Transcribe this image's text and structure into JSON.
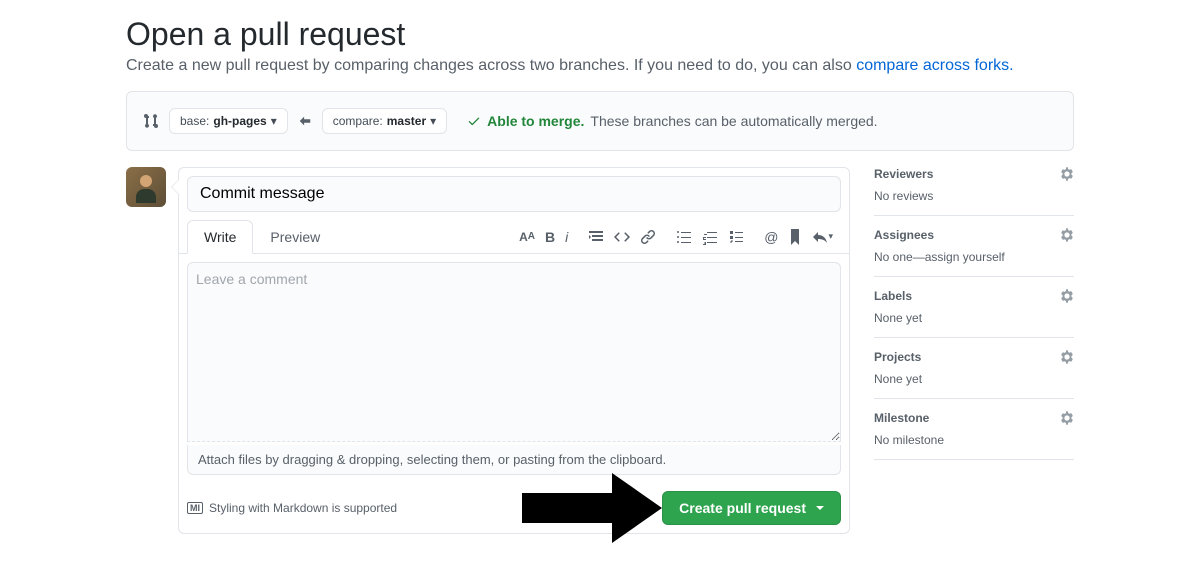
{
  "header": {
    "title": "Open a pull request",
    "subtitle_prefix": "Create a new pull request by comparing changes across two branches. If you need to do, you can also ",
    "subtitle_link": "compare across forks."
  },
  "compare": {
    "base_label": "base: ",
    "base_branch": "gh-pages",
    "compare_label": "compare: ",
    "compare_branch": "master",
    "merge_ok_label": "Able to merge.",
    "merge_hint": "These branches can be automatically merged."
  },
  "form": {
    "title_value": "Commit message",
    "body_placeholder": "Leave a comment",
    "attach_hint": "Attach files by dragging & dropping, selecting them, or pasting from the clipboard.",
    "md_support": "Styling with Markdown is supported",
    "md_badge": "MI",
    "create_btn": "Create pull request"
  },
  "tabs": {
    "write": "Write",
    "preview": "Preview"
  },
  "sidebar": {
    "reviewers": {
      "title": "Reviewers",
      "text": "No reviews"
    },
    "assignees": {
      "title": "Assignees",
      "text_prefix": "No one—",
      "self_assign": "assign yourself"
    },
    "labels": {
      "title": "Labels",
      "text": "None yet"
    },
    "projects": {
      "title": "Projects",
      "text": "None yet"
    },
    "milestone": {
      "title": "Milestone",
      "text": "No milestone"
    }
  }
}
